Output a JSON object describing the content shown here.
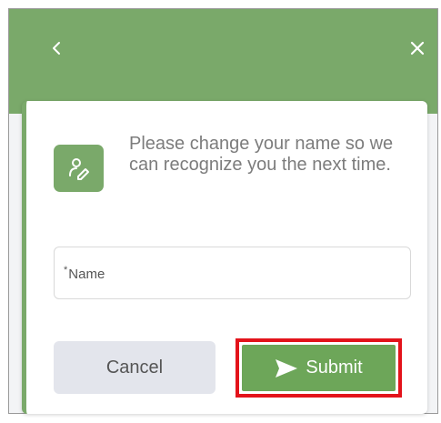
{
  "header": {
    "back_icon": "chevron-left-icon",
    "close_icon": "close-icon",
    "color": "#7aa96a"
  },
  "dialog": {
    "badge_icon": "user-edit-icon",
    "message": "Please change your name so we can recognize you the next time.",
    "name_field": {
      "required_marker": "*",
      "label": "Name",
      "value": ""
    },
    "cancel_label": "Cancel",
    "submit_label": "Submit",
    "submit_icon": "send-icon",
    "submit_color": "#6da659",
    "highlight_color": "#e3131b"
  }
}
